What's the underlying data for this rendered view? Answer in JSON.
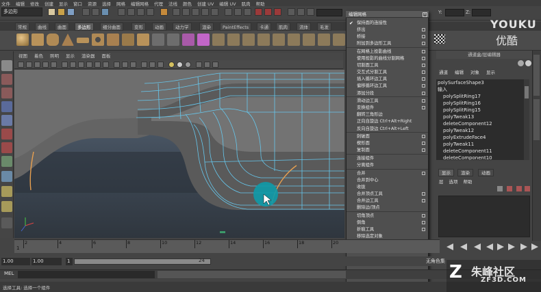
{
  "menubar": [
    "文件",
    "编辑",
    "修改",
    "创建",
    "显示",
    "窗口",
    "资源",
    "选择",
    "网格",
    "编辑网格",
    "代理",
    "法线",
    "颜色",
    "创建 UV",
    "编辑 UV",
    "肌肉",
    "帮助"
  ],
  "status_line": {
    "mode": "多边形",
    "x_label": "X:",
    "y_label": "Y:",
    "z_label": "Z:"
  },
  "shelf_tabs": [
    "常规",
    "曲线",
    "曲面",
    "多边形",
    "细分曲面",
    "变形",
    "动画",
    "动力学",
    "渲染",
    "PaintEffects",
    "卡通",
    "肌肉",
    "流体",
    "毛发"
  ],
  "shelf_active_tab": "多边形",
  "viewport_menu": [
    "视图",
    "着色",
    "照明",
    "显示",
    "渲染器",
    "面板"
  ],
  "viewport_label": "MED",
  "edit_mesh_menu": {
    "title": "编辑网格",
    "items": [
      {
        "label": "保持面的连接性",
        "checked": true,
        "option": false
      },
      {
        "label": "挤出",
        "option": true
      },
      {
        "label": "桥接",
        "option": true
      },
      {
        "label": "附加到多边形工具",
        "option": true
      },
      {
        "sep": true
      },
      {
        "label": "在网格上投影曲线",
        "option": true
      },
      {
        "label": "使用投影的曲线分割网格",
        "option": true
      },
      {
        "label": "切割面工具",
        "option": true
      },
      {
        "label": "交互式分割工具",
        "option": true
      },
      {
        "label": "插入循环边工具",
        "option": true
      },
      {
        "label": "偏移循环边工具",
        "option": true
      },
      {
        "label": "添加分段",
        "option": true
      },
      {
        "sep": true
      },
      {
        "label": "滑动边工具",
        "option": true
      },
      {
        "label": "变换组件",
        "option": true
      },
      {
        "label": "翻转三角形边",
        "option": false
      },
      {
        "label": "正向自旋边  Ctrl+Alt+Right",
        "option": false
      },
      {
        "label": "反向自旋边  Ctrl+Alt+Left",
        "option": false
      },
      {
        "sep": true
      },
      {
        "label": "刺破面",
        "option": true
      },
      {
        "label": "楔形面",
        "option": true
      },
      {
        "label": "复制面",
        "option": true
      },
      {
        "sep": true
      },
      {
        "label": "连接组件",
        "option": false
      },
      {
        "label": "分离组件",
        "option": false
      },
      {
        "sep": true
      },
      {
        "label": "合并",
        "option": true
      },
      {
        "label": "合并到中心",
        "option": false
      },
      {
        "label": "收拢",
        "option": false
      },
      {
        "label": "合并顶点工具",
        "option": true
      },
      {
        "label": "合并边工具",
        "option": true
      },
      {
        "label": "删除边/顶点",
        "option": false
      },
      {
        "sep": true
      },
      {
        "label": "切角顶点",
        "option": true
      },
      {
        "label": "倒角",
        "option": true
      },
      {
        "label": "折痕工具",
        "option": true
      },
      {
        "label": "移除选定对象",
        "option": false
      }
    ]
  },
  "channel_box": {
    "header": "通道盒/层编辑器",
    "menu": [
      "通道",
      "编辑",
      "对象",
      "显示"
    ],
    "object": "polySurfaceShape3",
    "inputs_label": "输入",
    "inputs": [
      "polySplitRing17",
      "polySplitRing16",
      "polySplitRing15",
      "polyTweak13",
      "deleteComponent12",
      "polyTweak12",
      "polyExtrudeFace4",
      "polyTweak11",
      "deleteComponent11",
      "deleteComponent10"
    ]
  },
  "layer_editor": {
    "tabs": [
      "显示",
      "渲染",
      "动画"
    ],
    "menu": [
      "层",
      "选项",
      "帮助"
    ]
  },
  "time_slider": {
    "ticks": [
      "2",
      "4",
      "6",
      "8",
      "10",
      "12",
      "14",
      "16",
      "18",
      "20"
    ],
    "current": "1"
  },
  "range_slider": {
    "start": "1.00",
    "start2": "1.00",
    "current": "1",
    "end": "24"
  },
  "anim_label": "无角色集",
  "cmdline": {
    "label": "MEL"
  },
  "help_line": "选择工具: 选择一个组件",
  "watermarks": {
    "youku": "YOUKU",
    "youku_cn": "优酷",
    "zf_cn": "朱峰社区",
    "zf_url": "ZF3D.COM"
  },
  "colors": {
    "wire": "#66c8ee",
    "highlight_circle": "#0e9aa8",
    "curve": "#e8a050"
  }
}
